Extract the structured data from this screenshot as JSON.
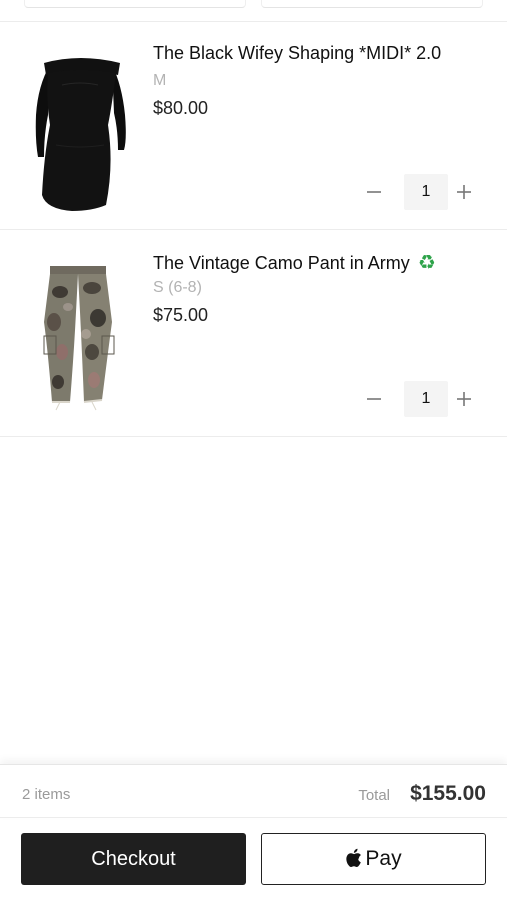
{
  "cart": {
    "items": [
      {
        "title": "The Black Wifey Shaping *MIDI* 2.0",
        "variant": "M",
        "price": "$80.00",
        "quantity": "1",
        "image_icon": "black-dress-image"
      },
      {
        "title": "The Vintage Camo Pant in Army",
        "title_emoji": "♻",
        "variant": "S (6-8)",
        "price": "$75.00",
        "quantity": "1",
        "image_icon": "camo-pants-image"
      }
    ]
  },
  "summary": {
    "item_count": "2 items",
    "total_label": "Total",
    "total_value": "$155.00"
  },
  "actions": {
    "checkout_label": "Checkout",
    "applepay_label": "Pay",
    "applepay_icon": "apple-icon"
  },
  "colors": {
    "checkout_bg": "#1f1f1f",
    "recycle_green": "#2ea34a",
    "variant_text": "#b3b3b3"
  }
}
